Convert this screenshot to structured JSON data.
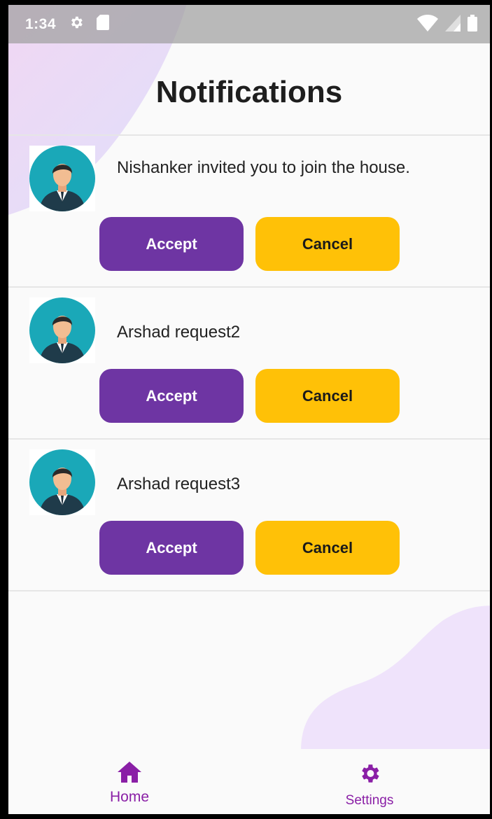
{
  "status_bar": {
    "time": "1:34",
    "icons": [
      "settings-icon",
      "sd-card-icon",
      "wifi-icon",
      "signal-icon",
      "battery-icon"
    ]
  },
  "page": {
    "title": "Notifications"
  },
  "notifications": [
    {
      "message": "Nishanker invited you to join the house.",
      "accept_label": "Accept",
      "cancel_label": "Cancel"
    },
    {
      "message": "Arshad request2",
      "accept_label": "Accept",
      "cancel_label": "Cancel"
    },
    {
      "message": "Arshad request3",
      "accept_label": "Accept",
      "cancel_label": "Cancel"
    }
  ],
  "bottom_nav": {
    "items": [
      {
        "label": "Home",
        "icon": "home-icon"
      },
      {
        "label": "Settings",
        "icon": "settings-icon"
      }
    ]
  },
  "colors": {
    "accept": "#6e35a3",
    "cancel": "#ffc107",
    "nav_active": "#8a1fa6",
    "avatar_bg": "#1aa8b8"
  }
}
